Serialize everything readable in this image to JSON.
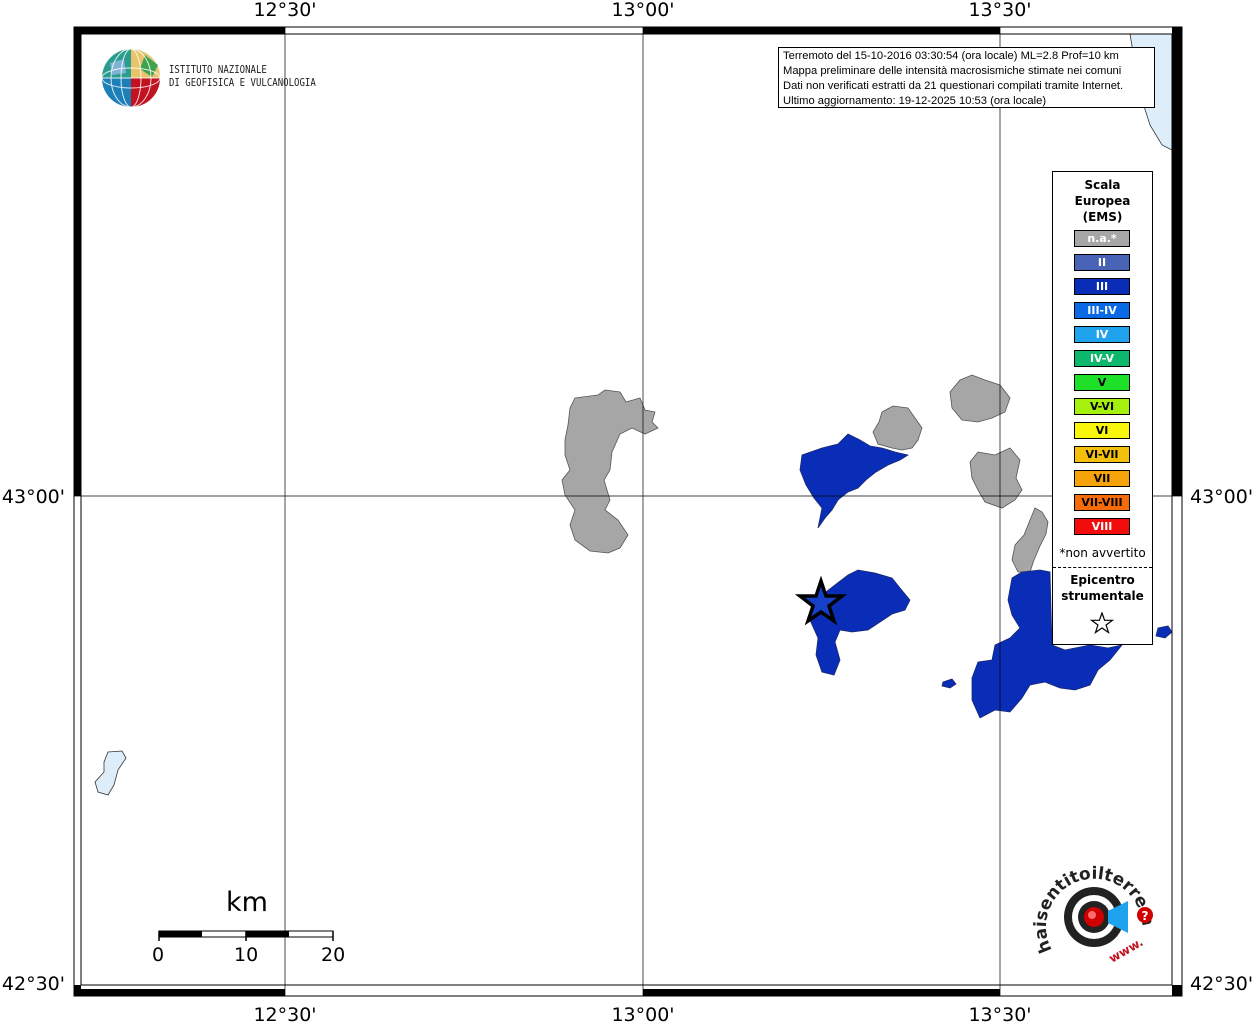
{
  "axes": {
    "lon_labels": [
      "12°30'",
      "13°00'",
      "13°30'"
    ],
    "lat_labels": [
      "43°00'",
      "42°30'"
    ]
  },
  "info": {
    "line1": "Terremoto del 15-10-2016 03:30:54 (ora locale) ML=2.8 Prof=10 km",
    "line2": "Mappa preliminare delle intensità macrosismiche stimate nei comuni",
    "line3": "Dati non verificati estratti da 21 questionari compilati tramite Internet.",
    "line4": "Ultimo aggiornamento: 19-12-2025 10:53 (ora locale)"
  },
  "legend": {
    "title": "Scala\nEuropea\n(EMS)",
    "items": [
      {
        "label": "n.a.*",
        "color": "#a6a6a6"
      },
      {
        "label": "II",
        "color": "#4863b5"
      },
      {
        "label": "III",
        "color": "#0a2db8"
      },
      {
        "label": "III-IV",
        "color": "#0a6ae6"
      },
      {
        "label": "IV",
        "color": "#1fa3ee"
      },
      {
        "label": "IV-V",
        "color": "#0db86d"
      },
      {
        "label": "V",
        "color": "#1fe028"
      },
      {
        "label": "V-VI",
        "color": "#a5f00d"
      },
      {
        "label": "VI",
        "color": "#f8f60a"
      },
      {
        "label": "VI-VII",
        "color": "#f5c00b"
      },
      {
        "label": "VII",
        "color": "#f6a20a"
      },
      {
        "label": "VII-VIII",
        "color": "#f56b0a"
      },
      {
        "label": "VIII",
        "color": "#f30c0c"
      }
    ],
    "note": "*non avvertito",
    "epicenter_label": "Epicentro\nstrumentale"
  },
  "scale": {
    "unit": "km",
    "ticks": [
      "0",
      "10",
      "20"
    ]
  },
  "ingv": {
    "name": "ISTITUTO NAZIONALE\nDI GEOFISICA E VULCANOLOGIA"
  },
  "hst": {
    "text": "haisentitoilterremoto.it",
    "www": "www."
  },
  "map_colors": {
    "na": "#a6a6a6",
    "III": "#0a2db8",
    "water": "#ddeefa"
  }
}
